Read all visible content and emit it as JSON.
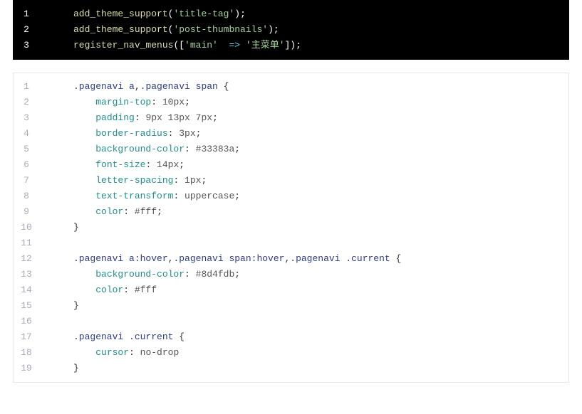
{
  "php_block": {
    "line_numbers": [
      "1",
      "2",
      "3"
    ],
    "lines": [
      [
        {
          "c": "fn",
          "t": "add_theme_support"
        },
        {
          "c": "punc",
          "t": "("
        },
        {
          "c": "str",
          "t": "'title-tag'"
        },
        {
          "c": "punc",
          "t": ");"
        }
      ],
      [
        {
          "c": "fn",
          "t": "add_theme_support"
        },
        {
          "c": "punc",
          "t": "("
        },
        {
          "c": "str",
          "t": "'post-thumbnails'"
        },
        {
          "c": "punc",
          "t": ");"
        }
      ],
      [
        {
          "c": "fn",
          "t": "register_nav_menus"
        },
        {
          "c": "punc",
          "t": "(["
        },
        {
          "c": "str",
          "t": "'main'"
        },
        {
          "c": "punc",
          "t": "  "
        },
        {
          "c": "op",
          "t": "=>"
        },
        {
          "c": "punc",
          "t": " "
        },
        {
          "c": "str",
          "t": "'主菜单'"
        },
        {
          "c": "punc",
          "t": "]);"
        }
      ]
    ]
  },
  "css_block": {
    "line_numbers": [
      "1",
      "2",
      "3",
      "4",
      "5",
      "6",
      "7",
      "8",
      "9",
      "10",
      "11",
      "12",
      "13",
      "14",
      "15",
      "16",
      "17",
      "18",
      "19"
    ],
    "lines": [
      [
        {
          "c": "sel",
          "t": ".pagenavi a"
        },
        {
          "c": "punc",
          "t": ","
        },
        {
          "c": "sel",
          "t": ".pagenavi span "
        },
        {
          "c": "punc",
          "t": "{"
        }
      ],
      [
        {
          "c": "punc",
          "t": "    "
        },
        {
          "c": "prop",
          "t": "margin-top"
        },
        {
          "c": "punc",
          "t": ": "
        },
        {
          "c": "val",
          "t": "10px"
        },
        {
          "c": "punc",
          "t": ";"
        }
      ],
      [
        {
          "c": "punc",
          "t": "    "
        },
        {
          "c": "prop",
          "t": "padding"
        },
        {
          "c": "punc",
          "t": ": "
        },
        {
          "c": "val",
          "t": "9px 13px 7px"
        },
        {
          "c": "punc",
          "t": ";"
        }
      ],
      [
        {
          "c": "punc",
          "t": "    "
        },
        {
          "c": "prop",
          "t": "border-radius"
        },
        {
          "c": "punc",
          "t": ": "
        },
        {
          "c": "val",
          "t": "3px"
        },
        {
          "c": "punc",
          "t": ";"
        }
      ],
      [
        {
          "c": "punc",
          "t": "    "
        },
        {
          "c": "prop",
          "t": "background-color"
        },
        {
          "c": "punc",
          "t": ": "
        },
        {
          "c": "val",
          "t": "#33383a"
        },
        {
          "c": "punc",
          "t": ";"
        }
      ],
      [
        {
          "c": "punc",
          "t": "    "
        },
        {
          "c": "prop",
          "t": "font-size"
        },
        {
          "c": "punc",
          "t": ": "
        },
        {
          "c": "val",
          "t": "14px"
        },
        {
          "c": "punc",
          "t": ";"
        }
      ],
      [
        {
          "c": "punc",
          "t": "    "
        },
        {
          "c": "prop",
          "t": "letter-spacing"
        },
        {
          "c": "punc",
          "t": ": "
        },
        {
          "c": "val",
          "t": "1px"
        },
        {
          "c": "punc",
          "t": ";"
        }
      ],
      [
        {
          "c": "punc",
          "t": "    "
        },
        {
          "c": "prop",
          "t": "text-transform"
        },
        {
          "c": "punc",
          "t": ": "
        },
        {
          "c": "val",
          "t": "uppercase"
        },
        {
          "c": "punc",
          "t": ";"
        }
      ],
      [
        {
          "c": "punc",
          "t": "    "
        },
        {
          "c": "prop",
          "t": "color"
        },
        {
          "c": "punc",
          "t": ": "
        },
        {
          "c": "val",
          "t": "#fff"
        },
        {
          "c": "punc",
          "t": ";"
        }
      ],
      [
        {
          "c": "punc",
          "t": "}"
        }
      ],
      [],
      [
        {
          "c": "sel",
          "t": ".pagenavi a:hover"
        },
        {
          "c": "punc",
          "t": ","
        },
        {
          "c": "sel",
          "t": ".pagenavi span:hover"
        },
        {
          "c": "punc",
          "t": ","
        },
        {
          "c": "sel",
          "t": ".pagenavi .current "
        },
        {
          "c": "punc",
          "t": "{"
        }
      ],
      [
        {
          "c": "punc",
          "t": "    "
        },
        {
          "c": "prop",
          "t": "background-color"
        },
        {
          "c": "punc",
          "t": ": "
        },
        {
          "c": "val",
          "t": "#8d4fdb"
        },
        {
          "c": "punc",
          "t": ";"
        }
      ],
      [
        {
          "c": "punc",
          "t": "    "
        },
        {
          "c": "prop",
          "t": "color"
        },
        {
          "c": "punc",
          "t": ": "
        },
        {
          "c": "val",
          "t": "#fff"
        }
      ],
      [
        {
          "c": "punc",
          "t": "}"
        }
      ],
      [],
      [
        {
          "c": "sel",
          "t": ".pagenavi .current "
        },
        {
          "c": "punc",
          "t": "{"
        }
      ],
      [
        {
          "c": "punc",
          "t": "    "
        },
        {
          "c": "prop",
          "t": "cursor"
        },
        {
          "c": "punc",
          "t": ": "
        },
        {
          "c": "val",
          "t": "no-drop"
        }
      ],
      [
        {
          "c": "punc",
          "t": "}"
        }
      ]
    ]
  }
}
